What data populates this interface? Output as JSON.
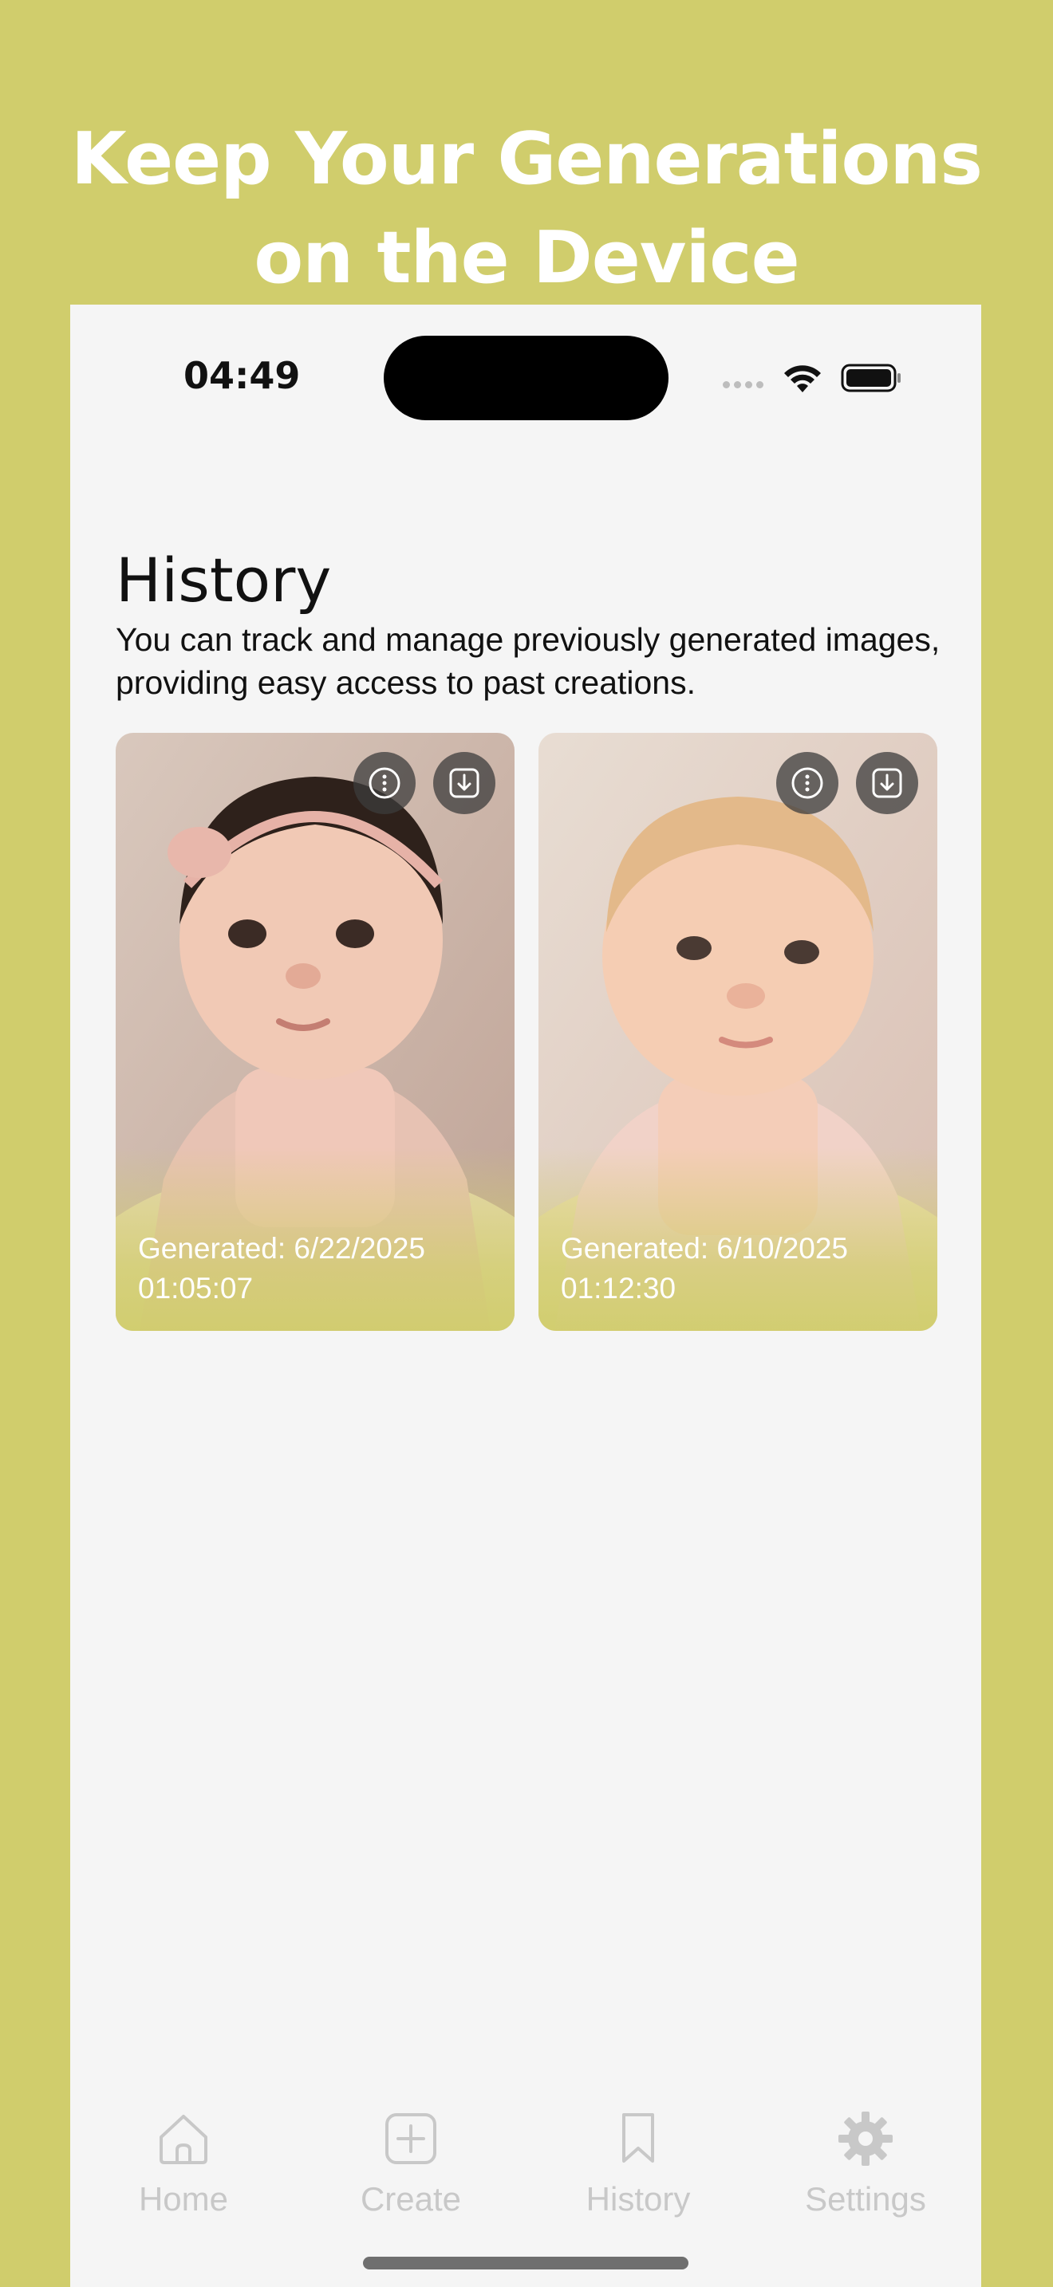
{
  "headline": {
    "line1": "Keep Your Generations",
    "line2": "on the Device"
  },
  "status_bar": {
    "time": "04:49"
  },
  "page": {
    "title": "History",
    "description": "You can track and manage previously generated images, providing easy access to past creations."
  },
  "history_items": [
    {
      "generated_label": "Generated: 6/22/2025",
      "time": "01:05:07"
    },
    {
      "generated_label": "Generated: 6/10/2025",
      "time": "01:12:30"
    }
  ],
  "tabs": [
    {
      "label": "Home",
      "icon": "home-icon"
    },
    {
      "label": "Create",
      "icon": "plus-square-icon"
    },
    {
      "label": "History",
      "icon": "bookmark-icon"
    },
    {
      "label": "Settings",
      "icon": "gear-icon"
    }
  ],
  "colors": {
    "background": "#d0cd6c",
    "screen": "#f5f5f5",
    "inactive_tab": "#c8c8c8"
  }
}
